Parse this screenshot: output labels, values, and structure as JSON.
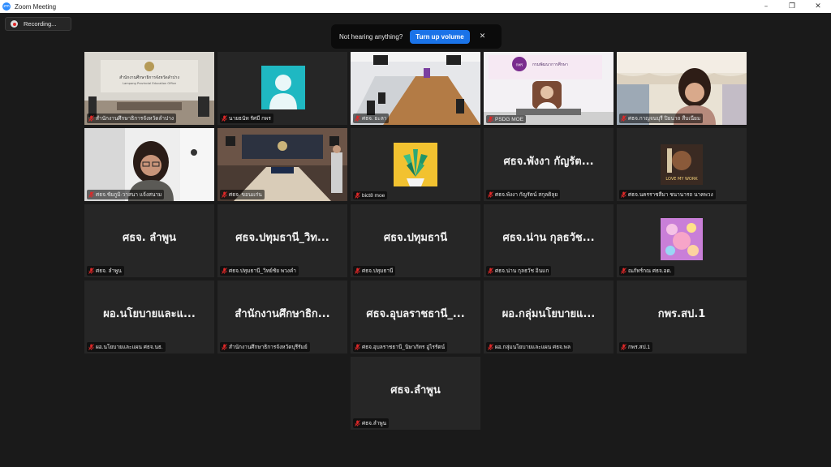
{
  "window": {
    "title": "Zoom Meeting",
    "app_icon_text": "zm",
    "controls": [
      "–",
      "❐",
      "✕"
    ]
  },
  "recording": {
    "label": "Recording..."
  },
  "audio_banner": {
    "message": "Not hearing anything?",
    "button": "Turn up volume",
    "close": "✕"
  },
  "tiles": [
    {
      "label": "สำนักงานศึกษาธิการจังหวัดลำปาง",
      "center": "",
      "video": "office",
      "active": false
    },
    {
      "label": "นายธนัท รัศมี กพร",
      "center": "",
      "video": "avatar",
      "active": false
    },
    {
      "label": "ศธจ. ยะลา",
      "center": "",
      "video": "meetingroom",
      "active": false
    },
    {
      "label": "PSDG MOE",
      "center": "",
      "video": "speaker",
      "active": true
    },
    {
      "label": "ศธจ.กาญจนบุรี ปิยนาถ สืบเนียม",
      "center": "",
      "video": "woman-curtain",
      "active": false
    },
    {
      "label": "ศธจ.ชัยภูมิ-วาสนา แจ้งสนาม",
      "center": "",
      "video": "woman-glasses",
      "active": false
    },
    {
      "label": "ศธจ. ขอนแก่น",
      "center": "",
      "video": "conference",
      "active": false
    },
    {
      "label": "bict8 moe",
      "center": "",
      "video": "plant",
      "active": false
    },
    {
      "label": "ศธจ.พังงา กัญรัตน์ สกุลดิลุย",
      "center": "ศธจ.พังงา กัญรัต...",
      "video": "",
      "active": false
    },
    {
      "label": "ศธจ.นครราชสีมา ชนานารถ นาคพวง",
      "center": "",
      "video": "poster",
      "active": false
    },
    {
      "label": "ศธจ. ลำพูน",
      "center": "ศธจ. ลำพูน",
      "video": "",
      "active": false
    },
    {
      "label": "ศธจ.ปทุมธานี_วิทย์ชัย พวงคำ",
      "center": "ศธจ.ปทุมธานี_วิท...",
      "video": "",
      "active": false
    },
    {
      "label": "ศธจ.ปทุมธานี",
      "center": "ศธจ.ปทุมธานี",
      "video": "",
      "active": false
    },
    {
      "label": "ศธจ.น่าน กุลธวัช อินแก",
      "center": "ศธจ.น่าน กุลธวัช...",
      "video": "",
      "active": false
    },
    {
      "label": "ณภัทร์กณ ศธจ.อด.",
      "center": "",
      "video": "sticker",
      "active": false
    },
    {
      "label": "ผอ.นโยบายและแผน ศธจ.นธ.",
      "center": "ผอ.นโยบายและแ...",
      "video": "",
      "active": false
    },
    {
      "label": "สำนักงานศึกษาธิการจังหวัดบุรีรัมย์",
      "center": "สำนักงานศึกษาธิก...",
      "video": "",
      "active": false
    },
    {
      "label": "ศธจ.อุบลราชธานี_นิษาภัทร อู่ไรรัตน์",
      "center": "ศธจ.อุบลราชธานี_...",
      "video": "",
      "active": false
    },
    {
      "label": "ผอ.กลุ่มนโยบายและแผน ศธจ.พล",
      "center": "ผอ.กลุ่มนโยบายแ...",
      "video": "",
      "active": false
    },
    {
      "label": "กพร.สป.1",
      "center": "กพร.สป.1",
      "video": "",
      "active": false
    },
    {
      "label": "ศธจ.ลำพูน",
      "center": "ศธจ.ลำพูน",
      "video": "",
      "active": false
    }
  ],
  "tile_fragments": {
    "office_sign_1": "สำนักงานศึกษาธิการจังหวัดลำปาง",
    "office_sign_2": "Lampang Provincial Education Office",
    "speaker_sign": "กรมพัฒนาการศึกษา",
    "speaker_logo": "กพร",
    "poster_text": "LOVE MY WORK"
  },
  "colors": {
    "background": "#1a1a1a",
    "tile": "#262626",
    "active_border": "#d6e58a",
    "banner_button": "#1a73e8",
    "mic_muted": "#e02828"
  }
}
